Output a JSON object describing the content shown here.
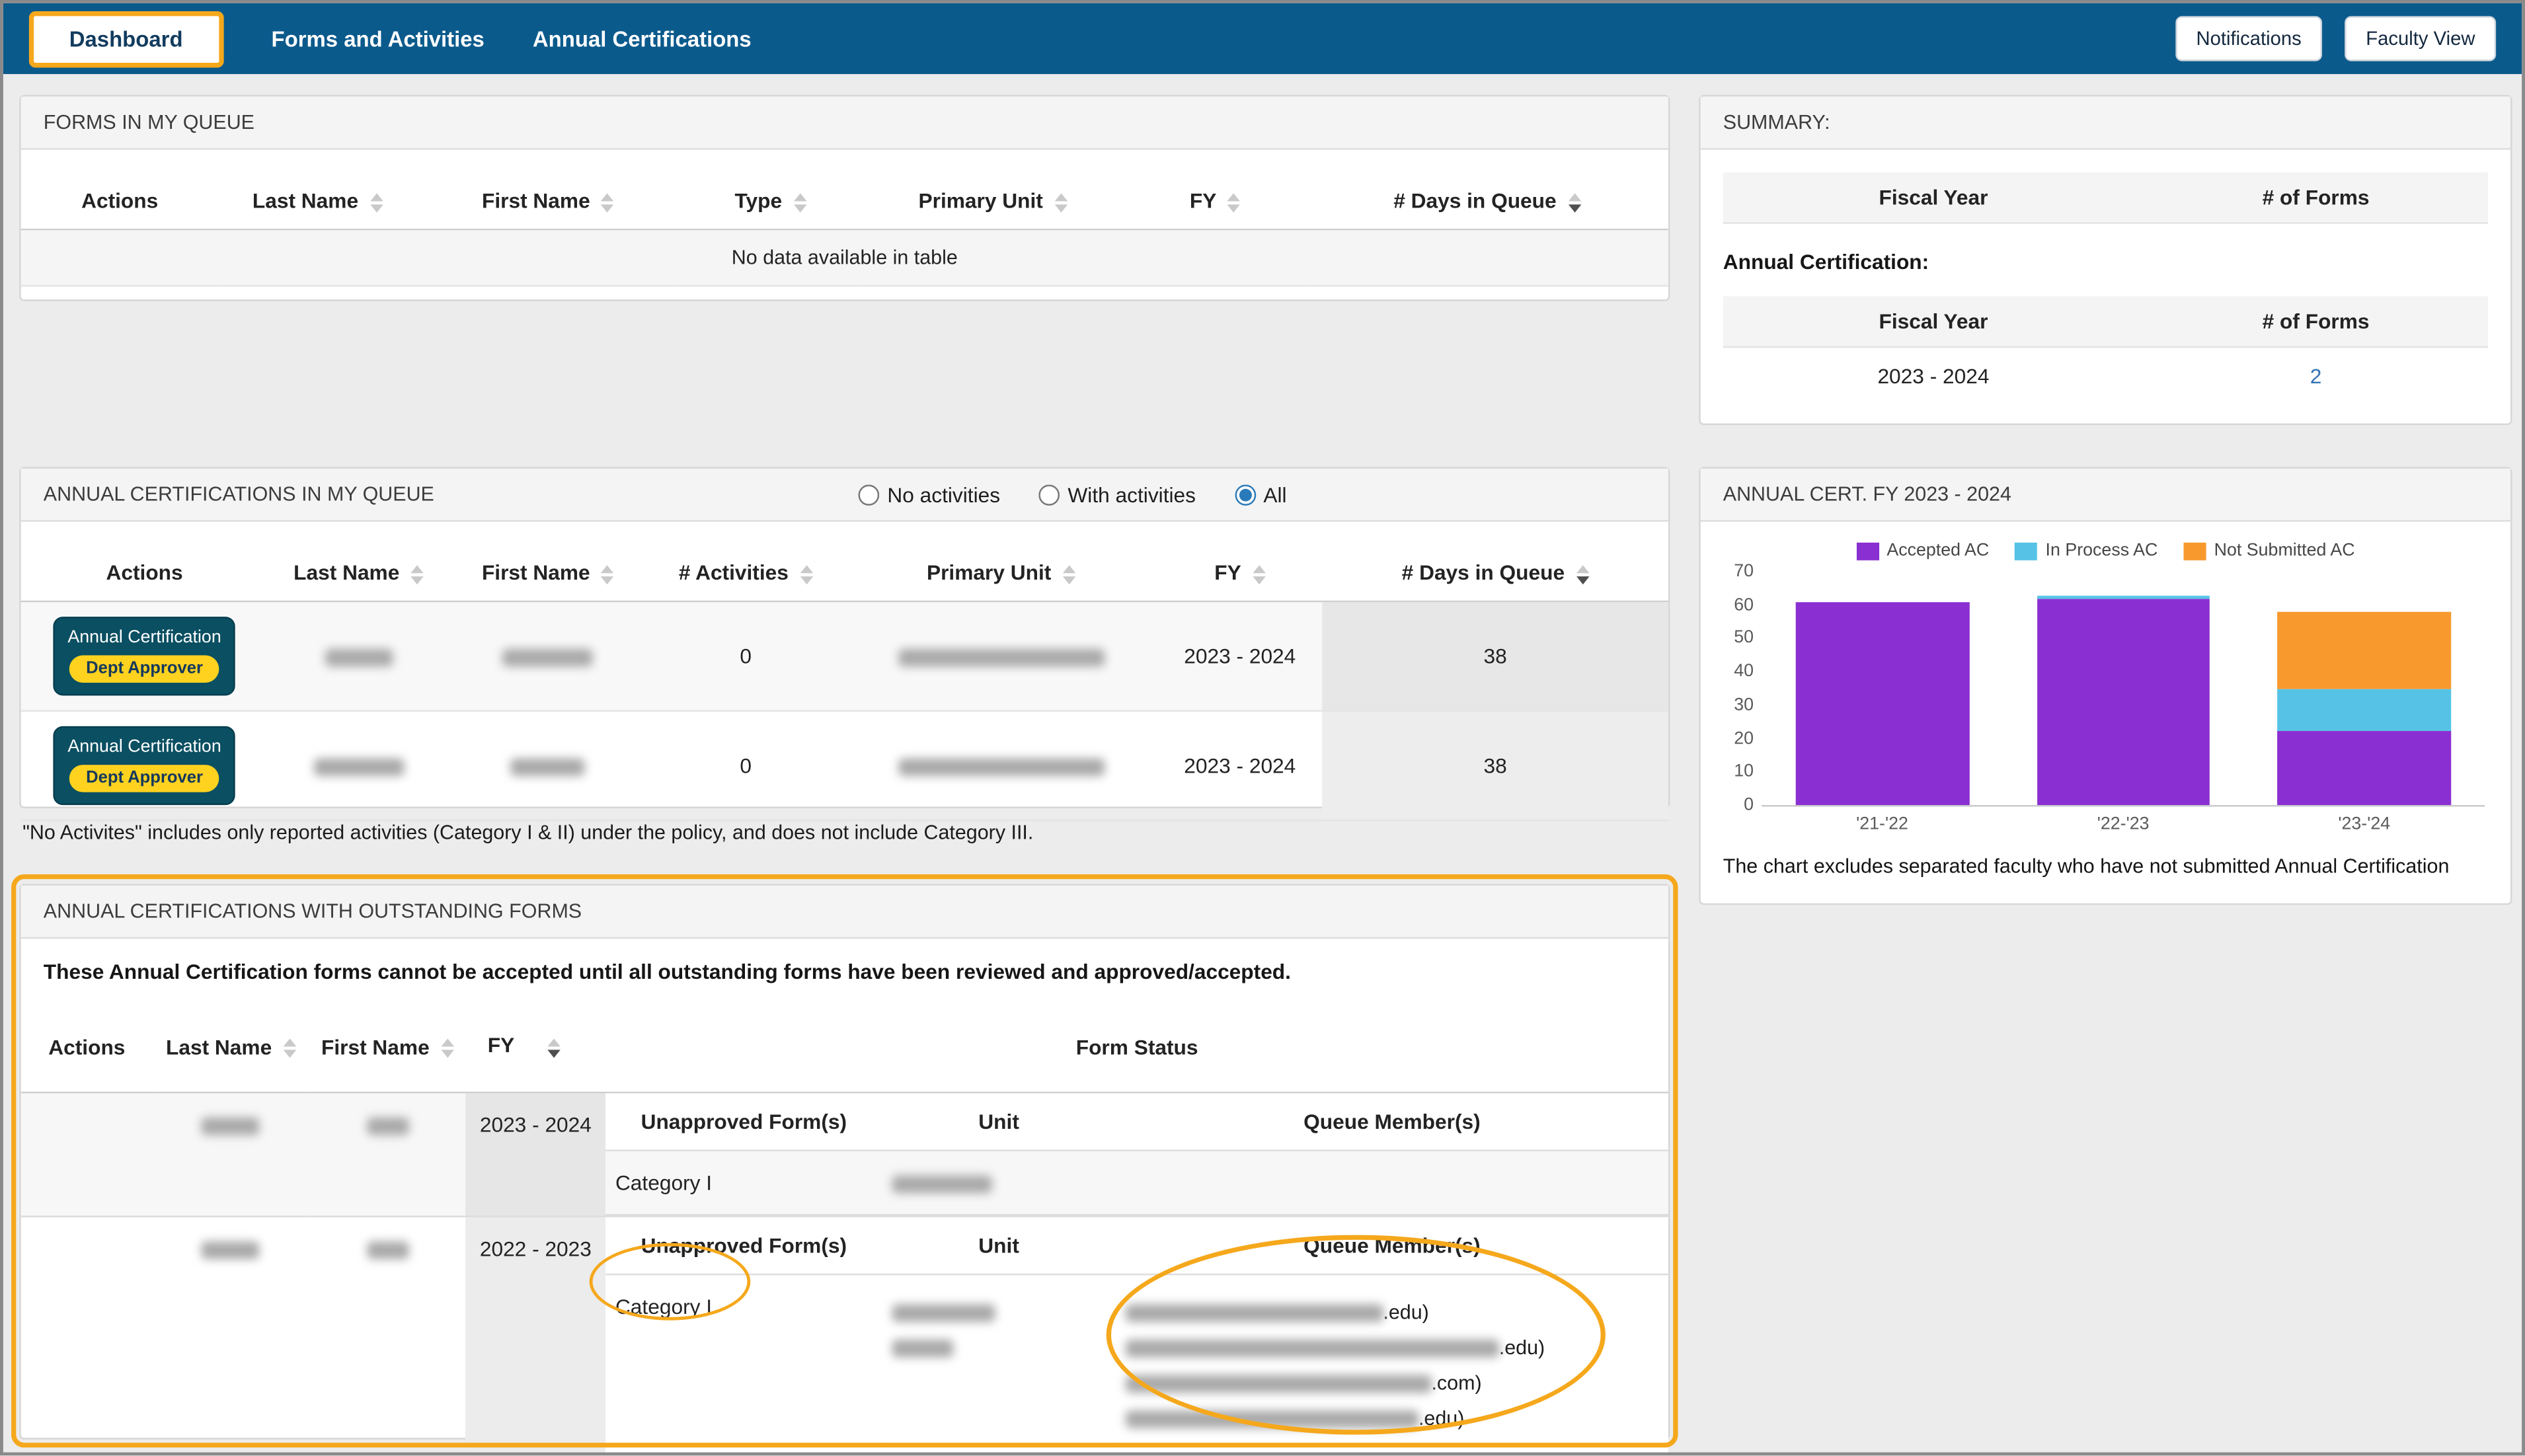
{
  "nav": {
    "tabs": [
      {
        "label": "Dashboard",
        "active": true
      },
      {
        "label": "Forms and Activities",
        "active": false
      },
      {
        "label": "Annual Certifications",
        "active": false
      }
    ],
    "buttons": [
      {
        "label": "Notifications"
      },
      {
        "label": "Faculty View"
      }
    ]
  },
  "forms_queue": {
    "title": "FORMS IN MY QUEUE",
    "columns": [
      "Actions",
      "Last Name",
      "First Name",
      "Type",
      "Primary Unit",
      "FY",
      "# Days in Queue"
    ],
    "empty_message": "No data available in table"
  },
  "ac_queue": {
    "title": "ANNUAL CERTIFICATIONS IN MY QUEUE",
    "filters": [
      {
        "label": "No activities",
        "checked": false
      },
      {
        "label": "With activities",
        "checked": false
      },
      {
        "label": "All",
        "checked": true
      }
    ],
    "columns": [
      "Actions",
      "Last Name",
      "First Name",
      "# Activities",
      "Primary Unit",
      "FY",
      "# Days in Queue"
    ],
    "rows": [
      {
        "action_label": "Annual Certification",
        "action_badge": "Dept Approver",
        "activities": "0",
        "fy": "2023 - 2024",
        "days_in_queue": "38"
      },
      {
        "action_label": "Annual Certification",
        "action_badge": "Dept Approver",
        "activities": "0",
        "fy": "2023 - 2024",
        "days_in_queue": "38"
      }
    ],
    "footnote": "\"No Activites\" includes only reported activities (Category I & II) under the policy, and does not include Category III."
  },
  "outstanding": {
    "title": "ANNUAL CERTIFICATIONS WITH OUTSTANDING FORMS",
    "description": "These Annual Certification forms cannot be accepted until all outstanding forms have been reviewed and approved/accepted.",
    "columns": [
      "Actions",
      "Last Name",
      "First Name",
      "FY",
      "Form Status"
    ],
    "nested_columns": [
      "Unapproved Form(s)",
      "Unit",
      "Queue Member(s)"
    ],
    "rows": [
      {
        "fy": "2023 - 2024",
        "form_name": "Category I",
        "queue_member_suffixes": []
      },
      {
        "fy": "2022 - 2023",
        "form_name": "Category I",
        "queue_member_suffixes": [
          ".edu)",
          ".edu)",
          ".com)",
          ".edu)"
        ]
      }
    ]
  },
  "summary": {
    "title": "SUMMARY:",
    "col_fiscal_year": "Fiscal Year",
    "col_forms": "# of Forms",
    "section_label": "Annual Certification:",
    "rows": [
      {
        "fiscal_year": "2023 - 2024",
        "num_forms": "2"
      }
    ]
  },
  "chart_panel": {
    "title": "ANNUAL CERT. FY 2023 - 2024",
    "caption": "The chart excludes separated faculty who have not submitted Annual Certification"
  },
  "chart_data": {
    "type": "bar",
    "stacked": true,
    "title": "ANNUAL CERT. FY 2023 - 2024",
    "categories": [
      "'21-'22",
      "'22-'23",
      "'23-'24"
    ],
    "series": [
      {
        "name": "Accepted AC",
        "color": "#8a2fd1",
        "values": [
          61,
          62,
          22
        ]
      },
      {
        "name": "In Process AC",
        "color": "#56c3e6",
        "values": [
          0,
          1,
          13
        ]
      },
      {
        "name": "Not Submitted AC",
        "color": "#f8992e",
        "values": [
          0,
          0,
          23
        ]
      }
    ],
    "ylim": [
      0,
      70
    ],
    "yticks": [
      0,
      10,
      20,
      30,
      40,
      50,
      60,
      70
    ],
    "legend_position": "top",
    "grid": false
  },
  "colors": {
    "nav_bg": "#0b5a8c",
    "highlight": "#f5a81c",
    "link": "#3273b5",
    "action_button_bg": "#0a4f62",
    "badge_bg": "#ffd21f"
  }
}
